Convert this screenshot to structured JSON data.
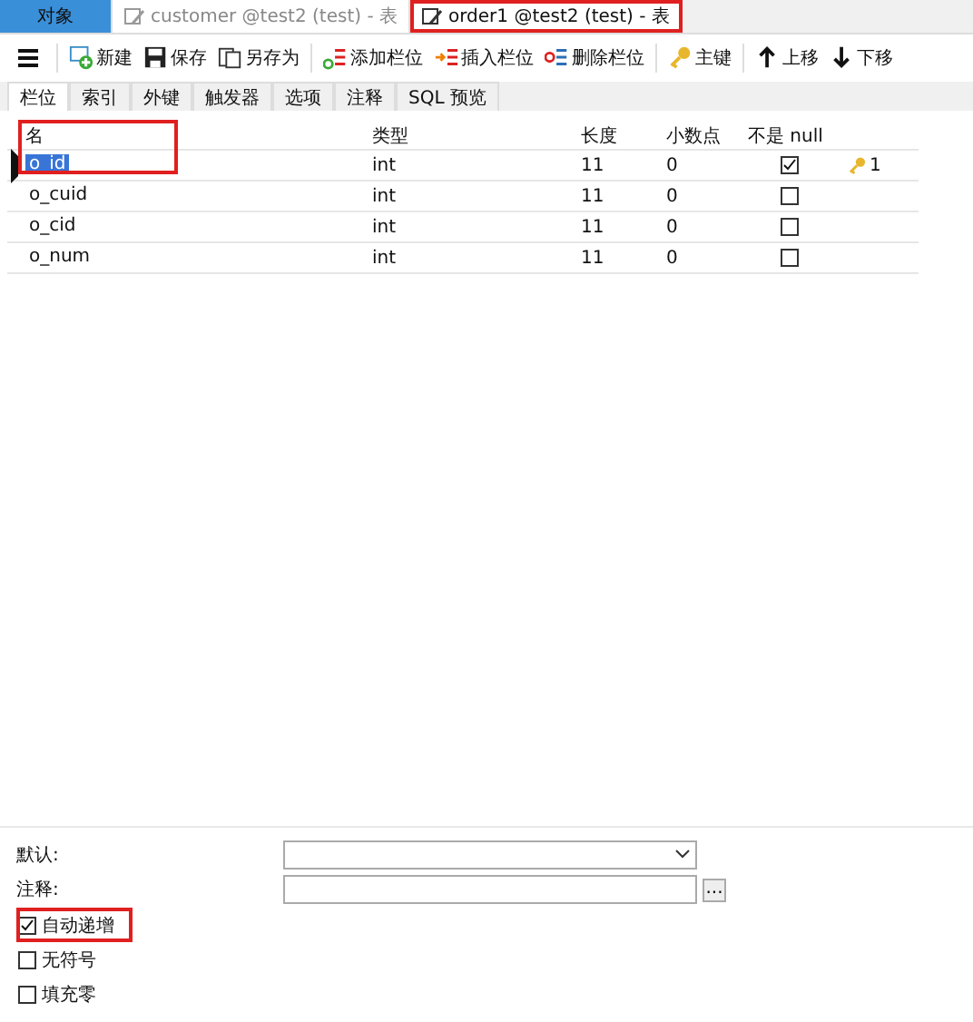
{
  "tabs": [
    {
      "label": "对象",
      "kind": "objects",
      "selected": false,
      "highlighted": false
    },
    {
      "label": "customer @test2 (test) - 表",
      "kind": "document",
      "selected": false,
      "highlighted": false
    },
    {
      "label": "order1 @test2 (test) - 表",
      "kind": "document",
      "selected": true,
      "highlighted": true
    }
  ],
  "toolbar": [
    {
      "label": "新建",
      "kind": "new"
    },
    {
      "label": "保存",
      "kind": "save"
    },
    {
      "label": "另存为",
      "kind": "saveas"
    },
    {
      "label": "添加栏位",
      "kind": "add"
    },
    {
      "label": "插入栏位",
      "kind": "insert"
    },
    {
      "label": "删除栏位",
      "kind": "delete"
    },
    {
      "label": "主键",
      "kind": "key"
    },
    {
      "label": "上移",
      "kind": "up"
    },
    {
      "label": "下移",
      "kind": "down"
    }
  ],
  "subtabs": [
    {
      "label": "栏位",
      "selected": true
    },
    {
      "label": "索引",
      "selected": false
    },
    {
      "label": "外键",
      "selected": false
    },
    {
      "label": "触发器",
      "selected": false
    },
    {
      "label": "选项",
      "selected": false
    },
    {
      "label": "注释",
      "selected": false
    },
    {
      "label": "SQL 预览",
      "selected": false
    }
  ],
  "table": {
    "columns": [
      {
        "label": "名",
        "highlighted": true
      },
      {
        "label": "类型",
        "highlighted": false
      },
      {
        "label": "长度",
        "highlighted": false
      },
      {
        "label": "小数点",
        "highlighted": false
      },
      {
        "label": "不是 null",
        "highlighted": false
      }
    ],
    "rows": [
      {
        "name": "o_id",
        "type": "int",
        "length": "11",
        "decimals": "0",
        "not_null": true,
        "key": "1",
        "selected": true
      },
      {
        "name": "o_cuid",
        "type": "int",
        "length": "11",
        "decimals": "0",
        "not_null": false,
        "selected": false
      },
      {
        "name": "o_cid",
        "type": "int",
        "length": "11",
        "decimals": "0",
        "not_null": false,
        "selected": false
      },
      {
        "name": "o_num",
        "type": "int",
        "length": "11",
        "decimals": "0",
        "not_null": false,
        "selected": false
      }
    ]
  },
  "properties": {
    "fields": [
      {
        "label": "默认:",
        "kind": "dropdown"
      },
      {
        "label": "注释:",
        "kind": "text",
        "button": "..."
      }
    ],
    "options": [
      {
        "label": "自动递增",
        "checked": true,
        "highlighted": true
      },
      {
        "label": "无符号",
        "checked": false,
        "highlighted": false
      },
      {
        "label": "填充零",
        "checked": false,
        "highlighted": false
      }
    ]
  }
}
